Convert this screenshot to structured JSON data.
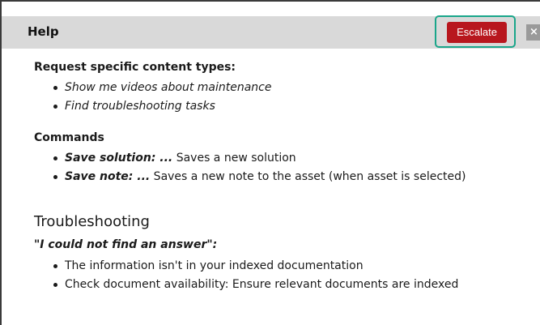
{
  "header": {
    "title": "Help",
    "escalate_label": "Escalate",
    "close_glyph": "×",
    "escalate_color": "#b8171e",
    "highlight_color": "#1aa68a"
  },
  "content_types": {
    "label": "Request specific content types:",
    "items": [
      "Show me videos about maintenance",
      "Find troubleshooting tasks"
    ]
  },
  "commands": {
    "label": "Commands",
    "items": [
      {
        "keyword": "Save solution: ...",
        "text": " Saves a new solution"
      },
      {
        "keyword": "Save note: ...",
        "text": " Saves a new note to the asset (when asset is selected)"
      }
    ]
  },
  "troubleshooting": {
    "heading": "Troubleshooting",
    "quote": "\"I could not find an answer\":",
    "items": [
      "The information isn't in your indexed documentation",
      "Check document availability: Ensure relevant documents are indexed"
    ]
  }
}
